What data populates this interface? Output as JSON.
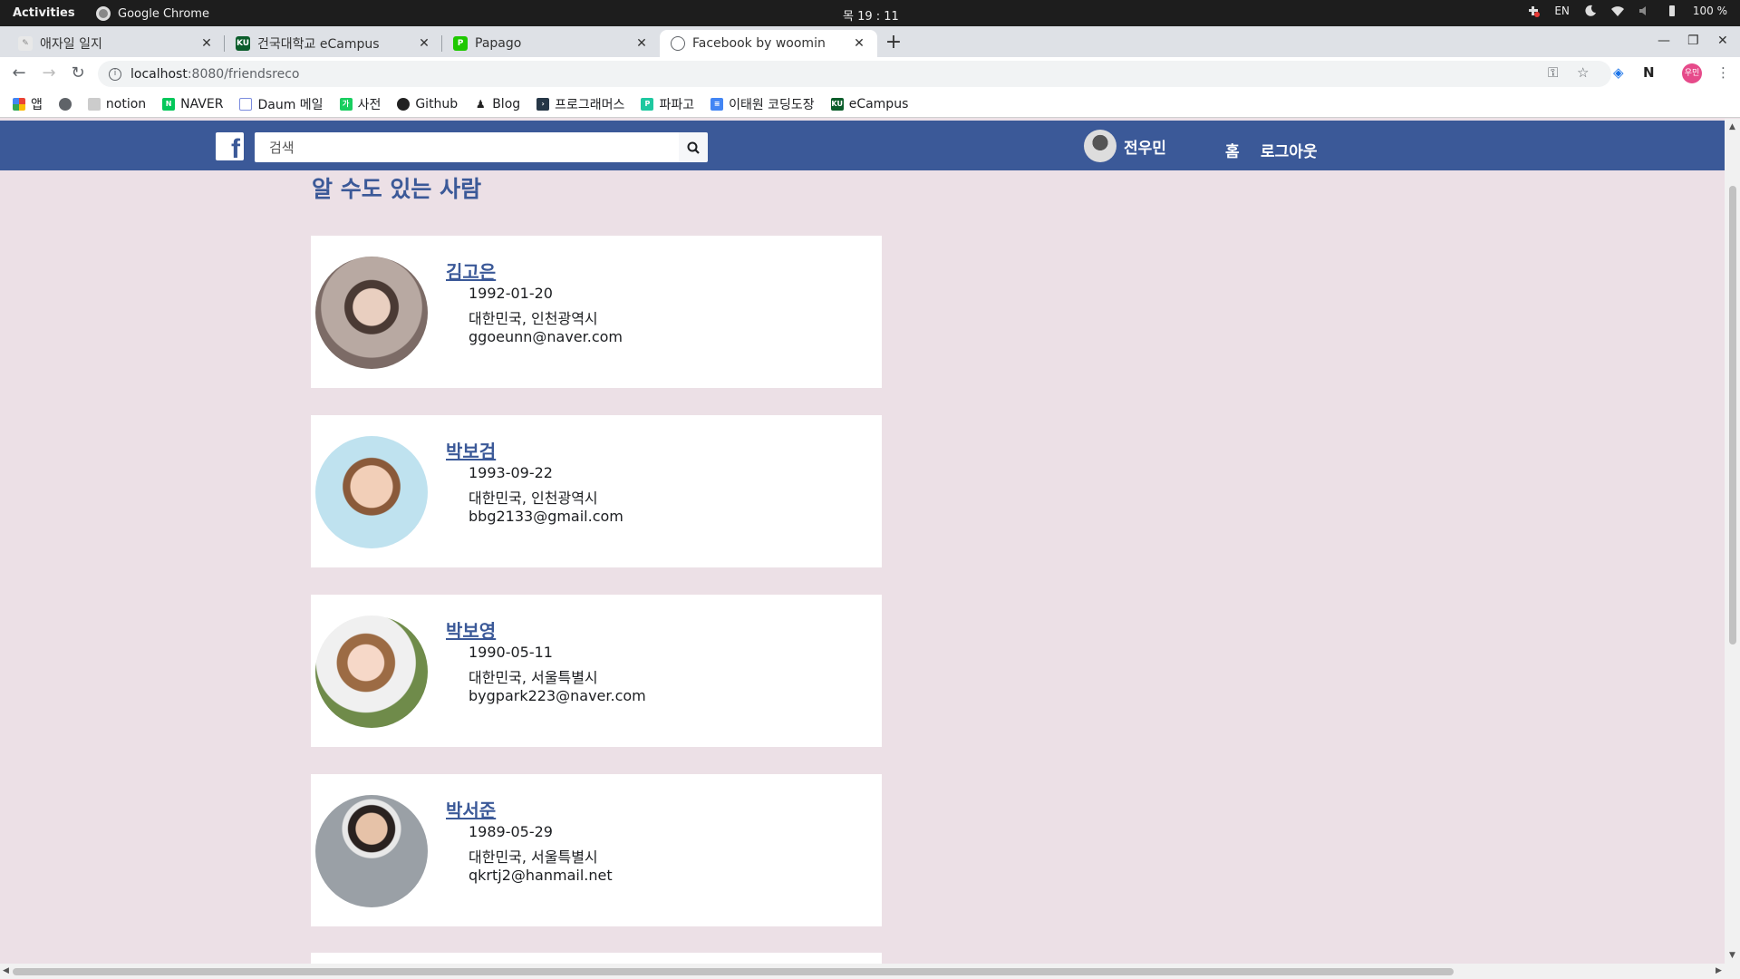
{
  "gnome": {
    "activities": "Activities",
    "app_name": "Google Chrome",
    "clock": "목 19 : 11",
    "lang": "EN",
    "battery": "100 %"
  },
  "tabs": [
    {
      "title": "애자일 일지",
      "active": false
    },
    {
      "title": "건국대학교 eCampus",
      "active": false
    },
    {
      "title": "Papago",
      "active": false
    },
    {
      "title": "Facebook by woomin",
      "active": true
    }
  ],
  "url": {
    "host": "localhost",
    "path": ":8080/friendsreco"
  },
  "bookmarks": [
    {
      "label": "앱",
      "icon": "apps-icon"
    },
    {
      "label": "",
      "icon": "globe-icon"
    },
    {
      "label": "notion",
      "icon": "notion-icon"
    },
    {
      "label": "NAVER",
      "icon": "naver-icon"
    },
    {
      "label": "Daum 메일",
      "icon": "mail-icon"
    },
    {
      "label": "사전",
      "icon": "dictionary-icon"
    },
    {
      "label": "Github",
      "icon": "github-icon"
    },
    {
      "label": "Blog",
      "icon": "person-icon"
    },
    {
      "label": "프로그래머스",
      "icon": "programmers-icon"
    },
    {
      "label": "파파고",
      "icon": "papago-icon"
    },
    {
      "label": "이태원 코딩도장",
      "icon": "doc-icon"
    },
    {
      "label": "eCampus",
      "icon": "ku-icon"
    }
  ],
  "header": {
    "search_placeholder": "검색",
    "user_name": "전우민",
    "home": "홈",
    "logout": "로그아웃"
  },
  "section_title": "알 수도 있는 사람",
  "friends": [
    {
      "name": "김고은",
      "birth": "1992-01-20",
      "location": "대한민국, 인천광역시",
      "email": "ggoeunn@naver.com"
    },
    {
      "name": "박보검",
      "birth": "1993-09-22",
      "location": "대한민국, 인천광역시",
      "email": "bbg2133@gmail.com"
    },
    {
      "name": "박보영",
      "birth": "1990-05-11",
      "location": "대한민국, 서울특별시",
      "email": "bygpark223@naver.com"
    },
    {
      "name": "박서준",
      "birth": "1989-05-29",
      "location": "대한민국, 서울특별시",
      "email": "qkrtj2@hanmail.net"
    }
  ],
  "colors": {
    "fb_blue": "#3b5998",
    "page_bg": "#ece0e6"
  }
}
